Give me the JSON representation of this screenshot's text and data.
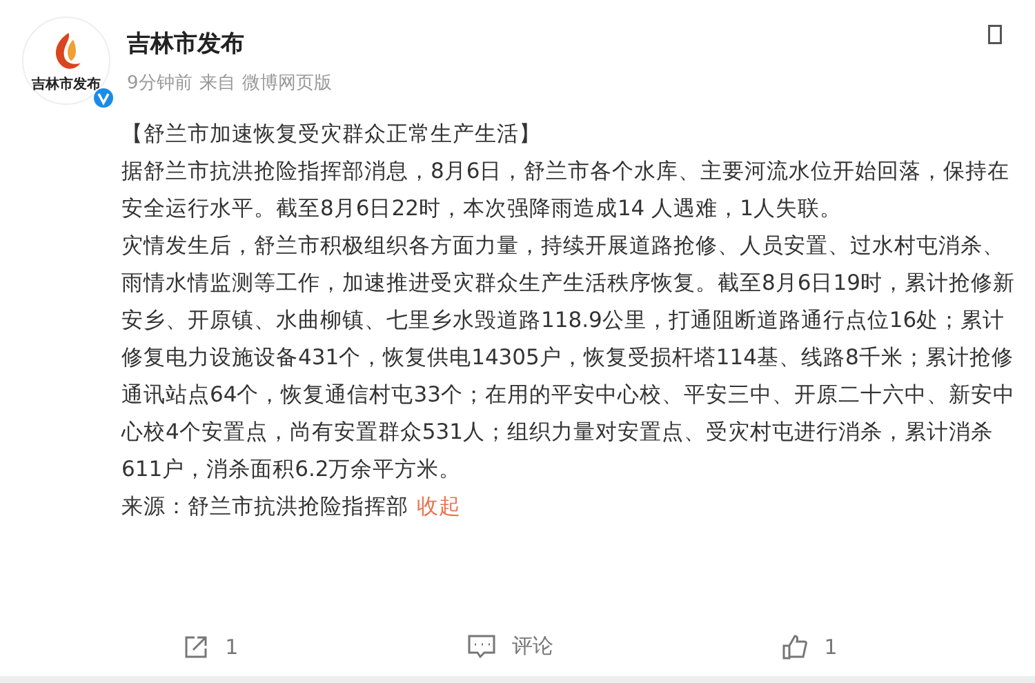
{
  "post": {
    "author": "吉林市发布",
    "verified": true,
    "avatar_text": "吉林市发布",
    "time": "9分钟前",
    "source_prefix": "来自",
    "client": "微博网页版",
    "paragraphs": [
      "【舒兰市加速恢复受灾群众正常生产生活】",
      "据舒兰市抗洪抢险指挥部消息，8月6日，舒兰市各个水库、主要河流水位开始回落，保持在安全运行水平。截至8月6日22时，本次强降雨造成14 人遇难，1人失联。",
      "灾情发生后，舒兰市积极组织各方面力量，持续开展道路抢修、人员安置、过水村屯消杀、雨情水情监测等工作，加速推进受灾群众生产生活秩序恢复。截至8月6日19时，累计抢修新安乡、开原镇、水曲柳镇、七里乡水毁道路118.9公里，打通阻断道路通行点位16处；累计修复电力设施设备431个，恢复供电14305户，恢复受损杆塔114基、线路8千米；累计抢修通讯站点64个，恢复通信村屯33个；在用的平安中心校、平安三中、开原二十六中、新安中心校4个安置点，尚有安置群众531人；组织力量对安置点、受灾村屯进行消杀，累计消杀611户，消杀面积6.2万余平方米。"
    ],
    "source_line": "来源：舒兰市抗洪抢险指挥部",
    "collapse_link": "收起"
  },
  "actions": [
    {
      "kind": "share",
      "label": "1"
    },
    {
      "kind": "comment",
      "label": "评论"
    },
    {
      "kind": "like",
      "label": "1"
    }
  ]
}
